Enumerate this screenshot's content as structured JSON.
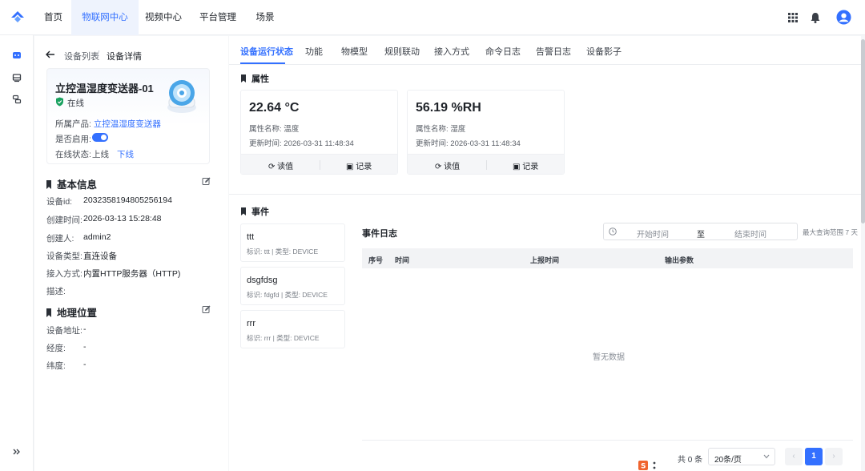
{
  "colors": {
    "accent": "#3370ff",
    "online": "#19a15f"
  },
  "nav": {
    "tabs": [
      "首页",
      "物联网中心",
      "视频中心",
      "平台管理",
      "场景"
    ],
    "active_index": 1
  },
  "breadcrumb": {
    "back_icon": "arrow-left-icon",
    "list": "设备列表",
    "separator": "/",
    "current": "设备详情"
  },
  "device": {
    "name": "立控温湿度变送器-01",
    "status": "在线",
    "product_label": "所属产品:",
    "product_value": "立控温湿度变送器",
    "enabled_label": "是否启用:",
    "enabled": true,
    "online_label": "在线状态:",
    "online_action": "上线",
    "offline_action": "下线"
  },
  "basic_info": {
    "title": "基本信息",
    "rows": [
      {
        "label": "设备id:",
        "value": "2032358194805256194"
      },
      {
        "label": "创建时间:",
        "value": "2026-03-13 15:28:48"
      },
      {
        "label": "创建人:",
        "value": "admin2"
      },
      {
        "label": "设备类型:",
        "value": "直连设备"
      },
      {
        "label": "接入方式:",
        "value": "内置HTTP服务器（HTTP)"
      },
      {
        "label": "描述:",
        "value": ""
      }
    ]
  },
  "geo": {
    "title": "地理位置",
    "rows": [
      {
        "label": "设备地址:",
        "value": "-"
      },
      {
        "label": "经度:",
        "value": "-"
      },
      {
        "label": "纬度:",
        "value": "-"
      }
    ]
  },
  "tabs": [
    "设备运行状态",
    "功能",
    "物模型",
    "规则联动",
    "接入方式",
    "命令日志",
    "告警日志",
    "设备影子"
  ],
  "properties": {
    "title": "属性",
    "items": [
      {
        "value": "22.64 °C",
        "name_label": "属性名称:",
        "name": "温度",
        "time_label": "更新时间:",
        "time": "2026-03-31 11:48:34",
        "read": "读值",
        "record": "记录"
      },
      {
        "value": "56.19 %RH",
        "name_label": "属性名称:",
        "name": "湿度",
        "time_label": "更新时间:",
        "time": "2026-03-31 11:48:34",
        "read": "读值",
        "record": "记录"
      }
    ]
  },
  "events": {
    "title": "事件",
    "items": [
      {
        "name": "ttt",
        "id_label": "标识: ttt",
        "type_label": "类型: DEVICE"
      },
      {
        "name": "dsgfdsg",
        "id_label": "标识: fdgfd",
        "type_label": "类型: DEVICE"
      },
      {
        "name": "rrr",
        "id_label": "标识: rrr",
        "type_label": "类型: DEVICE"
      }
    ]
  },
  "event_log": {
    "title": "事件日志",
    "start_placeholder": "开始时间",
    "range_sep": "至",
    "end_placeholder": "结束时间",
    "range_note": "最大查询范围 7 天",
    "columns": [
      "序号",
      "时间",
      "上报时间",
      "输出参数"
    ],
    "empty": "暂无数据",
    "total": "共 0 条",
    "page_size": "20条/页",
    "page": "1"
  }
}
